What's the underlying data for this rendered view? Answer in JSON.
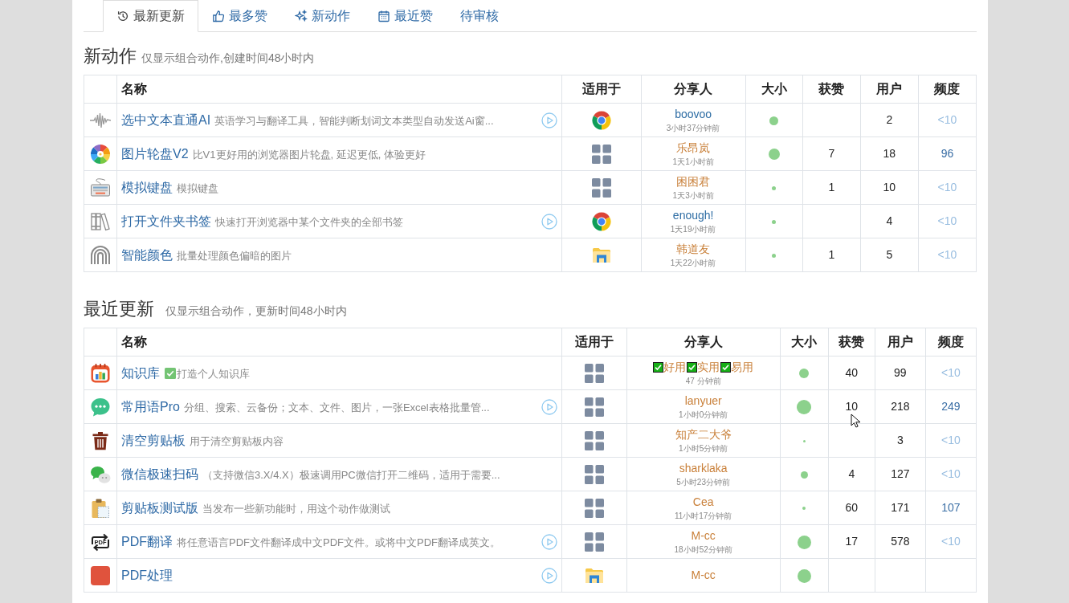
{
  "tabs": [
    {
      "label": "最新更新",
      "selected": true
    },
    {
      "label": "最多赞",
      "selected": false
    },
    {
      "label": "新动作",
      "selected": false
    },
    {
      "label": "最近赞",
      "selected": false
    },
    {
      "label": "待审核",
      "selected": false
    }
  ],
  "sections": [
    {
      "title": "新动作",
      "subtitle": "仅显示组合动作,创建时间48小时内",
      "columns": [
        "名称",
        "适用于",
        "分享人",
        "大小",
        "获赞",
        "用户",
        "频度"
      ],
      "rows": [
        {
          "name": "选中文本直通AI",
          "description": "英语学习与翻译工具，智能判断划词文本类型自动发送Ai窗...",
          "video": true,
          "sharer": {
            "name": "boovoo",
            "color": "#2e6da4",
            "time": "3小时37分钟前"
          },
          "users": "2",
          "frequency": {
            "text": "<10",
            "color": "#98bde0"
          }
        },
        {
          "name": "图片轮盘V2",
          "description": "比V1更好用的浏览器图片轮盘, 延迟更低, 体验更好",
          "video": false,
          "sharer": {
            "name": "乐昂岚",
            "color": "#c9803a",
            "time": "1天1小时前"
          },
          "likes": "7",
          "users": "18",
          "frequency": {
            "text": "96",
            "color": "#3a6ea5"
          }
        },
        {
          "name": "模拟键盘",
          "description": "模拟键盘",
          "video": false,
          "sharer": {
            "name": "困困君",
            "color": "#c9803a",
            "time": "1天3小时前"
          },
          "likes": "1",
          "users": "10",
          "frequency": {
            "text": "<10",
            "color": "#98bde0"
          }
        },
        {
          "name": "打开文件夹书签",
          "description": "快速打开浏览器中某个文件夹的全部书签",
          "video": true,
          "sharer": {
            "name": "enough!",
            "color": "#2e6da4",
            "time": "1天19小时前"
          },
          "users": "4",
          "frequency": {
            "text": "<10",
            "color": "#98bde0"
          }
        },
        {
          "name": "智能颜色",
          "description": "批量处理颜色偏暗的图片",
          "video": false,
          "sharer": {
            "name": "韩道友",
            "color": "#c9803a",
            "time": "1天22小时前"
          },
          "likes": "1",
          "users": "5",
          "frequency": {
            "text": "<10",
            "color": "#98bde0"
          }
        }
      ]
    },
    {
      "title": "最近更新",
      "subtitle": "仅显示组合动作，更新时间48小时内",
      "columns": [
        "名称",
        "适用于",
        "分享人",
        "大小",
        "获赞",
        "用户",
        "频度"
      ],
      "rows": [
        {
          "name": "知识库",
          "description_check": true,
          "description": "打造个人知识库",
          "video": false,
          "sharer": {
            "tags": [
              "好用",
              "实用",
              "易用"
            ],
            "color": "#c9803a",
            "time": "47 分钟前"
          },
          "likes": "40",
          "users": "99",
          "frequency": {
            "text": "<10",
            "color": "#98bde0"
          }
        },
        {
          "name": "常用语Pro",
          "description": "分组、搜索、云备份；文本、文件、图片，一张Excel表格批量管...",
          "video": true,
          "sharer": {
            "name": "lanyuer",
            "color": "#c9803a",
            "time": "1小时0分钟前"
          },
          "likes": "10",
          "pointer": true,
          "users": "218",
          "frequency": {
            "text": "249",
            "color": "#3a6ea5"
          }
        },
        {
          "name": "清空剪贴板",
          "description": "用于清空剪贴板内容",
          "video": false,
          "sharer": {
            "name": "知产二大爷",
            "color": "#c9803a",
            "time": "1小时5分钟前"
          },
          "users": "3",
          "frequency": {
            "text": "<10",
            "color": "#98bde0"
          }
        },
        {
          "name": "微信极速扫码",
          "description": "（支持微信3.X/4.X）极速调用PC微信打开二维码，适用于需要...",
          "video": false,
          "sharer": {
            "name": "sharklaka",
            "color": "#c9803a",
            "time": "5小时23分钟前"
          },
          "likes": "4",
          "users": "127",
          "frequency": {
            "text": "<10",
            "color": "#98bde0"
          }
        },
        {
          "name": "剪贴板测试版",
          "description": "当发布一些新功能时，用这个动作做测试",
          "video": false,
          "sharer": {
            "name": "Cea",
            "color": "#c9803a",
            "time": "11小时17分钟前"
          },
          "likes": "60",
          "users": "171",
          "frequency": {
            "text": "107",
            "color": "#3a6ea5"
          }
        },
        {
          "icon_label": "PDF",
          "name": "PDF翻译",
          "description": "将任意语言PDF文件翻译成中文PDF文件。或将中文PDF翻译成英文。",
          "video": true,
          "sharer": {
            "name": "M-cc",
            "color": "#c9803a",
            "time": "18小时52分钟前"
          },
          "likes": "17",
          "users": "578",
          "frequency": {
            "text": "<10",
            "color": "#98bde0"
          }
        },
        {
          "name": "PDF处理",
          "video": true,
          "sharer": {
            "name": "M-cc",
            "color": "#c9803a"
          }
        }
      ]
    }
  ]
}
